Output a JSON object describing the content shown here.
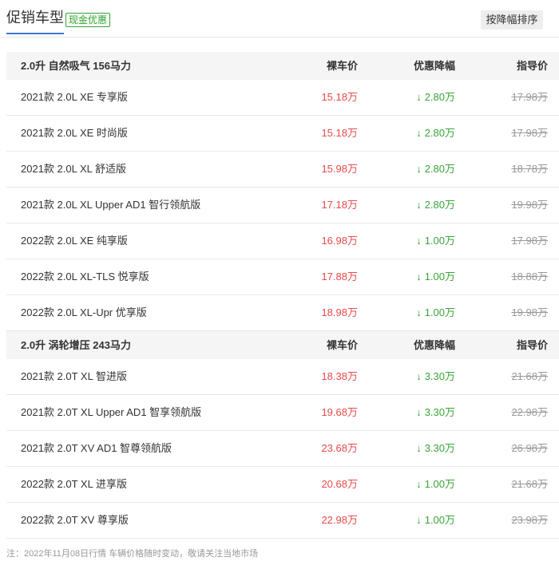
{
  "header": {
    "title": "促销车型",
    "badge": "现金优惠",
    "sort_label": "按降幅排序"
  },
  "columns": {
    "price": "裸车价",
    "discount": "优惠降幅",
    "guide": "指导价"
  },
  "groups": [
    {
      "title": "2.0升 自然吸气 156马力",
      "rows": [
        {
          "name": "2021款 2.0L XE 专享版",
          "price": "15.18万",
          "discount": "2.80万",
          "guide": "17.98万"
        },
        {
          "name": "2021款 2.0L XE 时尚版",
          "price": "15.18万",
          "discount": "2.80万",
          "guide": "17.98万"
        },
        {
          "name": "2021款 2.0L XL 舒适版",
          "price": "15.98万",
          "discount": "2.80万",
          "guide": "18.78万"
        },
        {
          "name": "2021款 2.0L XL Upper AD1 智行领航版",
          "price": "17.18万",
          "discount": "2.80万",
          "guide": "19.98万"
        },
        {
          "name": "2022款 2.0L XE 纯享版",
          "price": "16.98万",
          "discount": "1.00万",
          "guide": "17.98万"
        },
        {
          "name": "2022款 2.0L XL-TLS 悦享版",
          "price": "17.88万",
          "discount": "1.00万",
          "guide": "18.88万"
        },
        {
          "name": "2022款 2.0L XL-Upr 优享版",
          "price": "18.98万",
          "discount": "1.00万",
          "guide": "19.98万"
        }
      ]
    },
    {
      "title": "2.0升 涡轮增压 243马力",
      "rows": [
        {
          "name": "2021款 2.0T XL 智进版",
          "price": "18.38万",
          "discount": "3.30万",
          "guide": "21.68万"
        },
        {
          "name": "2021款 2.0T XL Upper AD1 智享领航版",
          "price": "19.68万",
          "discount": "3.30万",
          "guide": "22.98万"
        },
        {
          "name": "2021款 2.0T XV AD1 智尊领航版",
          "price": "23.68万",
          "discount": "3.30万",
          "guide": "26.98万"
        },
        {
          "name": "2022款 2.0T XL 进享版",
          "price": "20.68万",
          "discount": "1.00万",
          "guide": "21.68万"
        },
        {
          "name": "2022款 2.0T XV 尊享版",
          "price": "22.98万",
          "discount": "1.00万",
          "guide": "23.98万"
        }
      ]
    }
  ],
  "footer_note": "注：2022年11月08日行情 车辆价格随时变动，敬请关注当地市场",
  "icons": {
    "discount_arrow": "arrow-down-icon"
  },
  "colors": {
    "accent": "#3b79d6",
    "price": "#e84a4a",
    "discount": "#3aa33a",
    "guide": "#999999"
  }
}
